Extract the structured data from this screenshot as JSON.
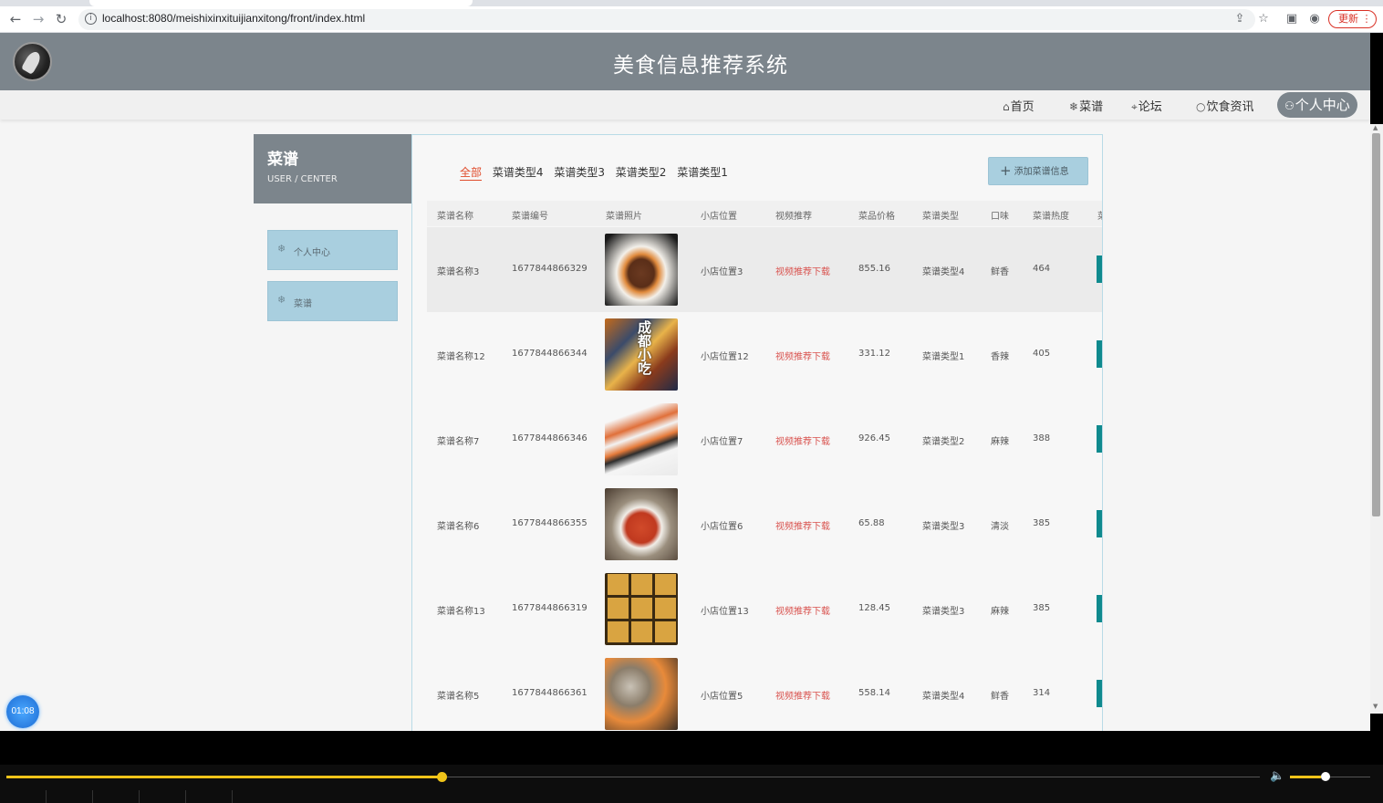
{
  "browser": {
    "url": "localhost:8080/meishixinxituijianxitong/front/index.html",
    "update_label": "更新"
  },
  "header": {
    "title": "美食信息推荐系统"
  },
  "nav": {
    "items": [
      {
        "icon": "⌂",
        "label": "首页"
      },
      {
        "icon": "❄",
        "label": "菜谱"
      },
      {
        "icon": "⌖",
        "label": "论坛"
      },
      {
        "icon": "○",
        "label": "饮食资讯"
      },
      {
        "icon": "⚇",
        "label": "个人中心"
      }
    ]
  },
  "sidebar": {
    "title": "菜谱",
    "subtitle": "USER / CENTER",
    "items": [
      {
        "icon": "❄",
        "label": "个人中心"
      },
      {
        "icon": "❄",
        "label": "菜谱"
      }
    ]
  },
  "filters": {
    "active": "全部",
    "categories": [
      "全部",
      "菜谱类型4",
      "菜谱类型3",
      "菜谱类型2",
      "菜谱类型1"
    ]
  },
  "add_button": "添加菜谱信息",
  "table": {
    "headers": [
      "菜谱名称",
      "菜谱编号",
      "菜谱照片",
      "小店位置",
      "视频推荐",
      "菜品价格",
      "菜谱类型",
      "口味",
      "菜谱热度",
      "菜"
    ],
    "rows": [
      {
        "name": "菜谱名称3",
        "code": "1677844866329",
        "location": "小店位置3",
        "video": "视频推荐下载",
        "price": "855.16",
        "type": "菜谱类型4",
        "taste": "鲜香",
        "heat": "464"
      },
      {
        "name": "菜谱名称12",
        "code": "1677844866344",
        "location": "小店位置12",
        "video": "视频推荐下载",
        "price": "331.12",
        "type": "菜谱类型1",
        "taste": "香辣",
        "heat": "405"
      },
      {
        "name": "菜谱名称7",
        "code": "1677844866346",
        "location": "小店位置7",
        "video": "视频推荐下载",
        "price": "926.45",
        "type": "菜谱类型2",
        "taste": "麻辣",
        "heat": "388"
      },
      {
        "name": "菜谱名称6",
        "code": "1677844866355",
        "location": "小店位置6",
        "video": "视频推荐下载",
        "price": "65.88",
        "type": "菜谱类型3",
        "taste": "清淡",
        "heat": "385"
      },
      {
        "name": "菜谱名称13",
        "code": "1677844866319",
        "location": "小店位置13",
        "video": "视频推荐下载",
        "price": "128.45",
        "type": "菜谱类型3",
        "taste": "麻辣",
        "heat": "385"
      },
      {
        "name": "菜谱名称5",
        "code": "1677844866361",
        "location": "小店位置5",
        "video": "视频推荐下载",
        "price": "558.14",
        "type": "菜谱类型4",
        "taste": "鲜香",
        "heat": "314"
      }
    ]
  },
  "timer": "01:08",
  "player": {
    "progress": 0.3475,
    "volume": 0.39
  }
}
